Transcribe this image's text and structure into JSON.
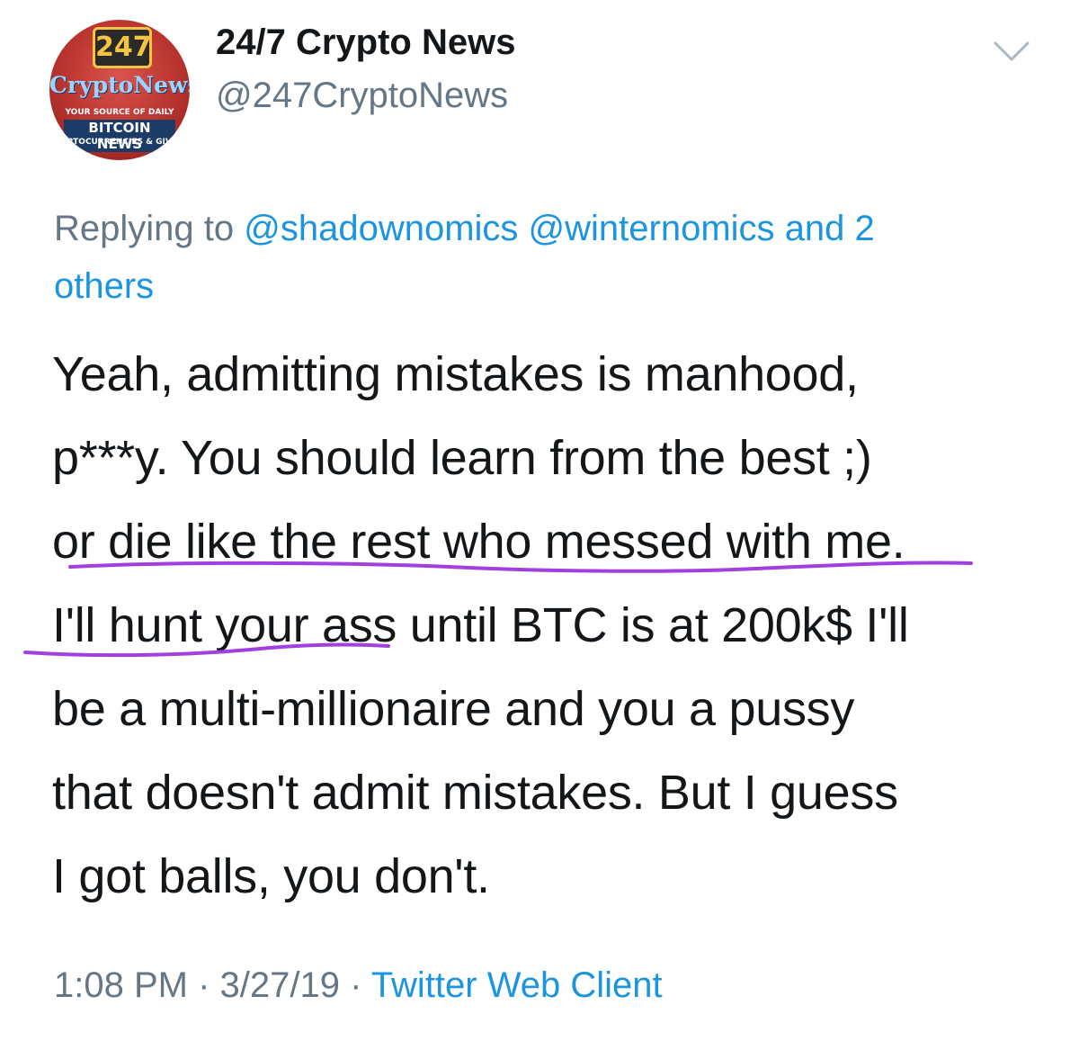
{
  "author": {
    "display_name": "24/7 Crypto News",
    "handle": "@247CryptoNews",
    "avatar": {
      "number": "247",
      "brand": "CryptoNews",
      "tagline_1": "YOUR SOURCE OF DAILY",
      "tagline_2": "BITCOIN NEWS",
      "tagline_3": "CRYPTOCURRENCIES & GIVEAWAYS"
    }
  },
  "menu_icon": "chevron-down-icon",
  "reply": {
    "prefix": "Replying to ",
    "mention_1": "@shadownomics",
    "mention_2": "@winternomics",
    "and_others_1": "and 2",
    "and_others_2": "others"
  },
  "tweet": {
    "lines": [
      "Yeah, admitting mistakes is manhood,",
      "p***y.  You should learn from the best ;)",
      "or die like the rest who messed with me.",
      "I'll hunt your ass until BTC is at 200k$ I'll",
      "be a multi-millionaire and you a pussy",
      "that doesn't admit mistakes. But I guess",
      "I got balls, you don't."
    ]
  },
  "meta": {
    "time": "1:08 PM",
    "separator": " · ",
    "date": "3/27/19",
    "client": "Twitter Web Client"
  },
  "colors": {
    "text": "#14171a",
    "secondary": "#657786",
    "link": "#1b95e0",
    "annotation": "#a23fe0"
  }
}
